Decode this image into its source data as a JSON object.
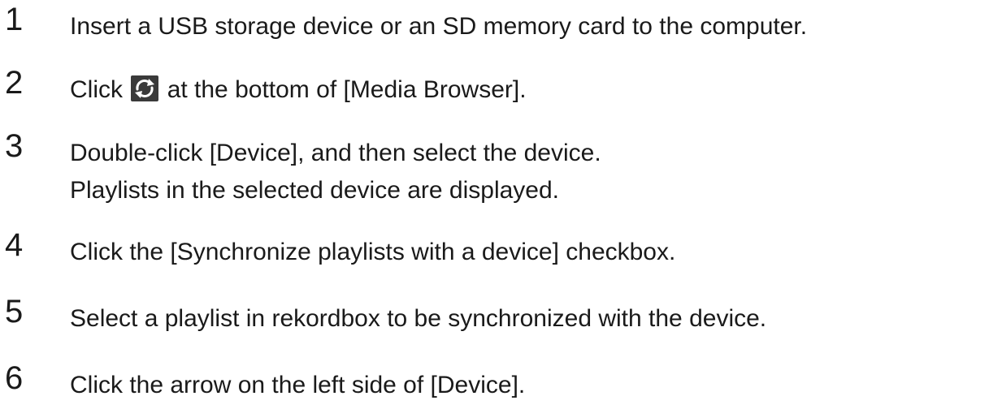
{
  "steps": [
    {
      "number": "1",
      "lines": [
        "Insert a USB storage device or an SD memory card to the computer."
      ]
    },
    {
      "number": "2",
      "before_icon": "Click",
      "icon": "sync-icon",
      "after_icon": "at the bottom of [Media Browser]."
    },
    {
      "number": "3",
      "lines": [
        "Double-click [Device], and then select the device.",
        "Playlists in the selected device are displayed."
      ]
    },
    {
      "number": "4",
      "lines": [
        "Click the [Synchronize playlists with a device] checkbox."
      ]
    },
    {
      "number": "5",
      "lines": [
        "Select a playlist in rekordbox to be synchronized with the device."
      ]
    },
    {
      "number": "6",
      "lines": [
        "Click the arrow on the left side of [Device]."
      ]
    }
  ],
  "colors": {
    "text": "#1a1a1a",
    "icon_bg": "#3a3a3a",
    "icon_fg": "#ffffff"
  }
}
